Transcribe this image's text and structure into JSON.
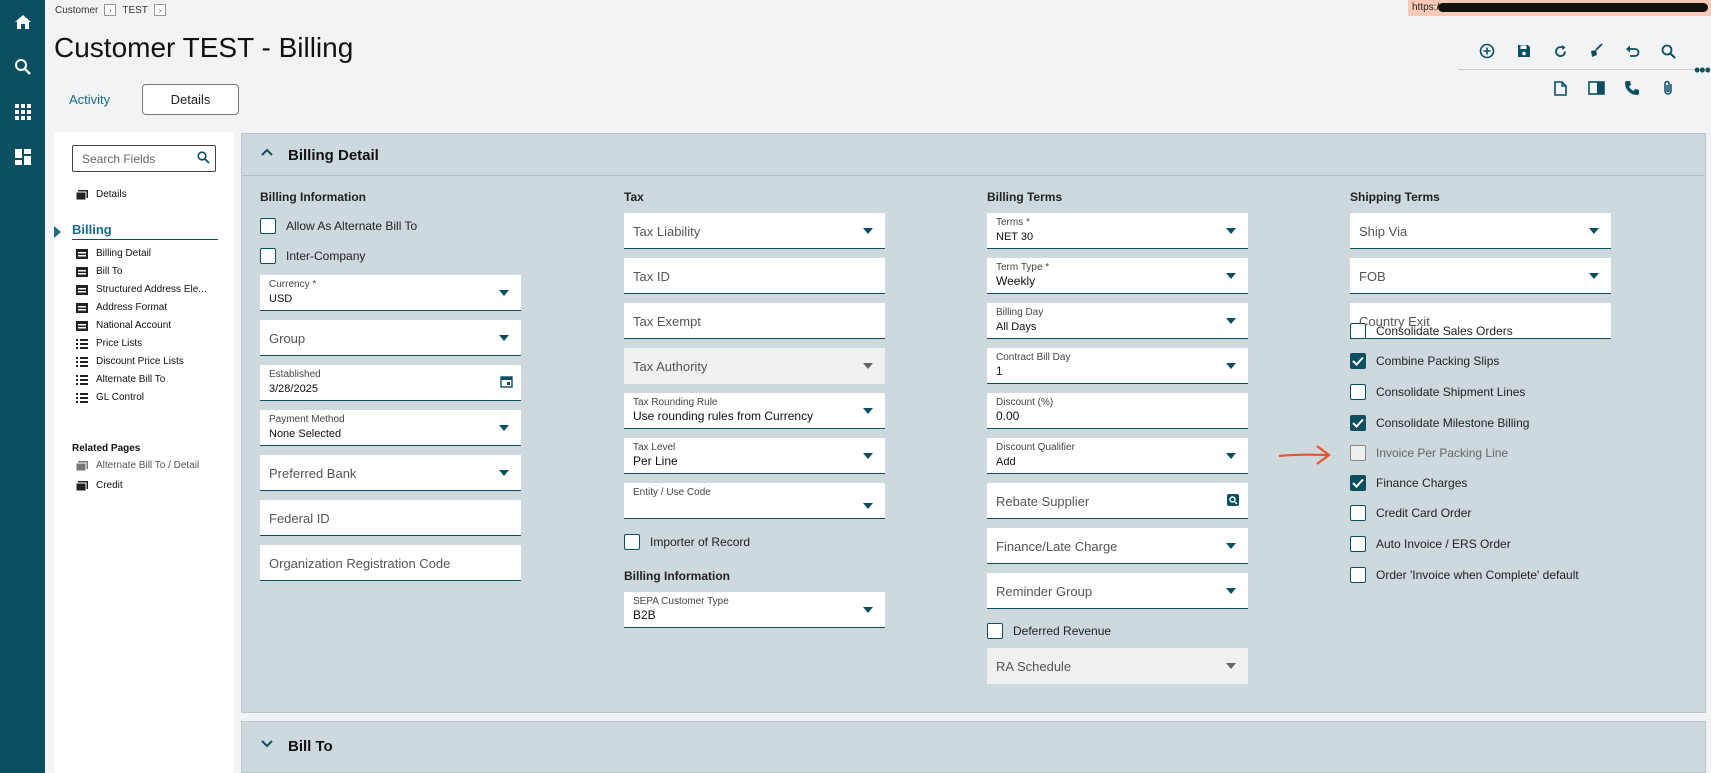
{
  "breadcrumb": [
    "Customer",
    "TEST"
  ],
  "url_prefix": "https:/",
  "page_title": "Customer TEST - Billing",
  "tabs": {
    "activity": "Activity",
    "details": "Details"
  },
  "sidebar": {
    "search_placeholder": "Search Fields",
    "details": "Details",
    "billing": "Billing",
    "items": [
      "Billing Detail",
      "Bill To",
      "Structured Address Ele...",
      "Address Format",
      "National Account",
      "Price Lists",
      "Discount Price Lists",
      "Alternate Bill To",
      "GL Control"
    ],
    "related_pages_label": "Related Pages",
    "related": [
      "Alternate Bill To / Detail",
      "Credit"
    ]
  },
  "panel": {
    "title": "Billing Detail",
    "next_section": "Bill To"
  },
  "billing_information": {
    "label": "Billing Information",
    "alternate_bill_to": "Allow As Alternate Bill To",
    "inter_company": "Inter-Company",
    "currency_label": "Currency *",
    "currency_value": "USD",
    "group": "Group",
    "established_label": "Established",
    "established_value": "3/28/2025",
    "payment_method_label": "Payment Method",
    "payment_method_value": "None Selected",
    "preferred_bank": "Preferred Bank",
    "federal_id": "Federal ID",
    "org_reg_code": "Organization Registration Code"
  },
  "tax": {
    "label": "Tax",
    "tax_liability": "Tax Liability",
    "tax_id": "Tax ID",
    "tax_exempt": "Tax Exempt",
    "tax_authority": "Tax Authority",
    "rounding_label": "Tax Rounding Rule",
    "rounding_value": "Use rounding rules from Currency",
    "level_label": "Tax Level",
    "level_value": "Per Line",
    "entity_label": "Entity / Use Code",
    "importer": "Importer of Record",
    "billing_info_label": "Billing Information",
    "sepa_label": "SEPA Customer Type",
    "sepa_value": "B2B"
  },
  "billing_terms": {
    "label": "Billing Terms",
    "terms_label": "Terms *",
    "terms_value": "NET 30",
    "term_type_label": "Term Type *",
    "term_type_value": "Weekly",
    "billing_day_label": "Billing Day",
    "billing_day_value": "All Days",
    "contract_bill_day_label": "Contract Bill Day",
    "contract_bill_day_value": "1",
    "discount_label": "Discount (%)",
    "discount_value": "0.00",
    "discount_qualifier_label": "Discount Qualifier",
    "discount_qualifier_value": "Add",
    "rebate_supplier": "Rebate Supplier",
    "finance_late": "Finance/Late Charge",
    "reminder_group": "Reminder Group",
    "deferred_revenue": "Deferred Revenue",
    "ra_schedule": "RA Schedule"
  },
  "shipping_terms": {
    "label": "Shipping Terms",
    "ship_via": "Ship Via",
    "fob": "FOB",
    "country_exit": "Country Exit",
    "checkboxes": [
      {
        "label": "Consolidate Sales Orders",
        "checked": false,
        "disabled": false
      },
      {
        "label": "Combine Packing Slips",
        "checked": true,
        "disabled": false
      },
      {
        "label": "Consolidate Shipment Lines",
        "checked": false,
        "disabled": false
      },
      {
        "label": "Consolidate Milestone Billing",
        "checked": true,
        "disabled": false
      },
      {
        "label": "Invoice Per Packing Line",
        "checked": false,
        "disabled": true
      },
      {
        "label": "Finance Charges",
        "checked": true,
        "disabled": false
      },
      {
        "label": "Credit Card Order",
        "checked": false,
        "disabled": false
      },
      {
        "label": "Auto Invoice / ERS Order",
        "checked": false,
        "disabled": false
      },
      {
        "label": "Order 'Invoice when Complete' default",
        "checked": false,
        "disabled": false
      }
    ]
  },
  "colors": {
    "rail": "#0b4f60",
    "panel": "#cdd9dd",
    "accent": "#1a6a8a",
    "annotation": "#e8552a"
  },
  "icons": [
    "home-icon",
    "search-icon",
    "apps-icon",
    "dashboard-icon",
    "add-icon",
    "save-icon",
    "refresh-icon",
    "clear-icon",
    "undo-icon",
    "find-icon",
    "document-icon",
    "book-icon",
    "phone-icon",
    "attachment-icon"
  ]
}
